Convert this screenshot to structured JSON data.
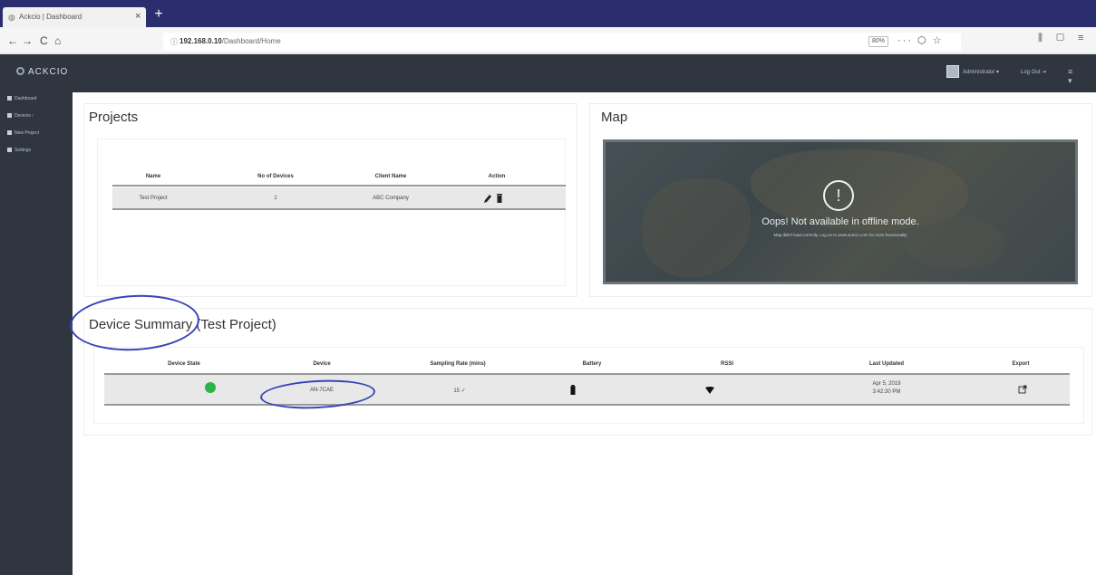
{
  "browser": {
    "tab_title": "Ackcio | Dashboard",
    "tab_close": "×",
    "new_tab": "+",
    "nav": {
      "back": "←",
      "forward": "→",
      "reload": "C",
      "home": "⌂"
    },
    "url_host": "192.168.0.10",
    "url_path": "/Dashboard/Home",
    "zoom": "80%",
    "url_tools": "··· ⬡ ☆",
    "right_tools": "⫼ ▢ ≡"
  },
  "app": {
    "brand": "ACKCIO",
    "user_name": "Administrator ▾",
    "logout": "Log Out ⇥",
    "menu": "≡ ▾"
  },
  "sidebar": {
    "items": [
      {
        "label": "Dashboard"
      },
      {
        "label": "Devices    ‹"
      },
      {
        "label": "New Project"
      },
      {
        "label": "Settings"
      }
    ]
  },
  "projects": {
    "title": "Projects",
    "columns": [
      "Name",
      "No of Devices",
      "Client Name",
      "Action"
    ],
    "rows": [
      {
        "name": "Test Project",
        "devices": "1",
        "client": "ABC Company"
      }
    ]
  },
  "map": {
    "title": "Map",
    "message": "Oops! Not available in offline mode.",
    "submessage": "Map didn't load correctly. Log on to www.ackcio.com for more functionality"
  },
  "device_summary": {
    "title": "Device Summary",
    "project": "(Test Project)",
    "columns": [
      "Device State",
      "Device",
      "Sampling Rate (mins)",
      "Battery",
      "RSSI",
      "Last Updated",
      "Export"
    ],
    "rows": [
      {
        "device": "AN-7CAE",
        "sampling_rate": "15 ✓",
        "last_updated_date": "Apr 5, 2019",
        "last_updated_time": "3:42:30 PM"
      }
    ],
    "status_color": "#2db34a"
  },
  "colors": {
    "header_bg": "#2f3640",
    "tab_strip_bg": "#2a2e6f",
    "annotation": "#3844b7"
  }
}
